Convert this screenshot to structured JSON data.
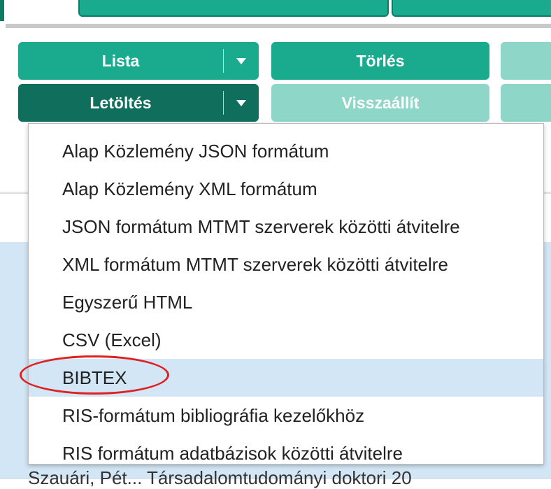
{
  "toolbar": {
    "lista_label": "Lista",
    "torles_label": "Törlés",
    "letoltes_label": "Letöltés",
    "visszaallit_label": "Visszaállít"
  },
  "download_menu": {
    "items": [
      "Alap Közlemény JSON formátum",
      "Alap Közlemény XML formátum",
      "JSON formátum MTMT szerverek közötti átvitelre",
      "XML formátum MTMT szerverek közötti átvitelre",
      "Egyszerű HTML",
      "CSV (Excel)",
      "BIBTEX",
      "RIS-formátum bibliográfia kezelőkhöz",
      "RIS formátum adatbázisok közötti átvitelre"
    ],
    "highlighted_index": 6
  },
  "background_row": {
    "text": "Szauári, Pét...      Társadalomtudományi doktori    20"
  },
  "colors": {
    "primary": "#1aab8f",
    "primary_dark": "#0f6e5c",
    "disabled": "#8dd6c8",
    "highlight": "#d2e6f5",
    "annotation": "#e02020"
  }
}
